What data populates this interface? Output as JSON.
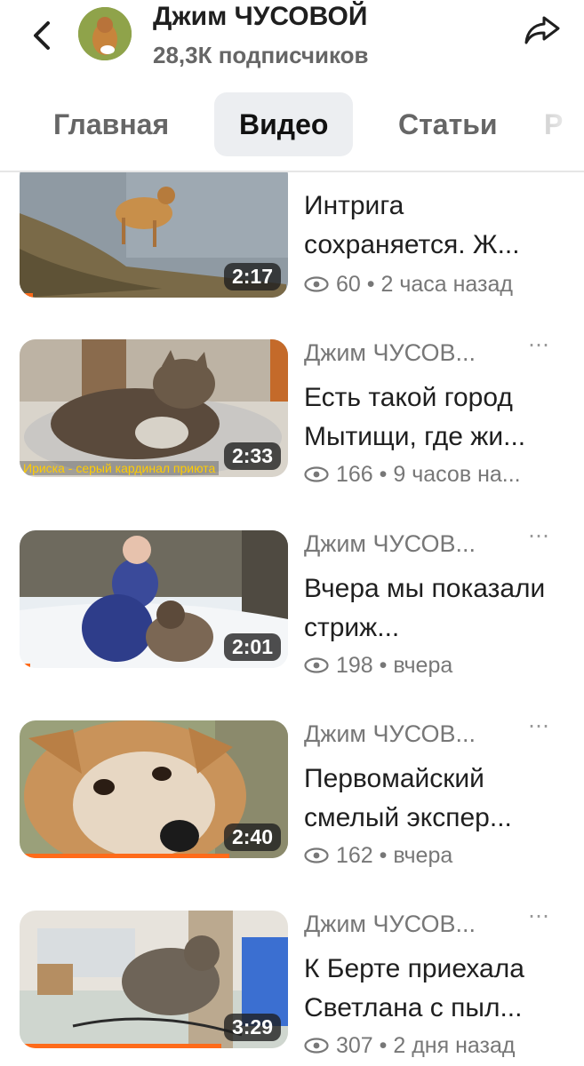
{
  "header": {
    "channel_name": "Джим ЧУСОВОЙ",
    "subscribers": "28,3К подписчиков"
  },
  "tabs": [
    {
      "label": "Главная",
      "active": false
    },
    {
      "label": "Видео",
      "active": true
    },
    {
      "label": "Статьи",
      "active": false
    },
    {
      "label": "Р",
      "active": false
    }
  ],
  "videos": [
    {
      "author": "",
      "title": "Интрига сохраняется. Ж...",
      "views": "60",
      "time": "2 часа назад",
      "duration": "2:17",
      "progress": 0.05,
      "caption": ""
    },
    {
      "author": "Джим ЧУСОВ...",
      "title": "Есть такой город Мытищи, где жи...",
      "views": "166",
      "time": "9 часов на...",
      "duration": "2:33",
      "progress": 0.0,
      "caption": "Ириска - серый кардинал приюта"
    },
    {
      "author": "Джим ЧУСОВ...",
      "title": "Вчера мы показали стриж...",
      "views": "198",
      "time": "вчера",
      "duration": "2:01",
      "progress": 0.04,
      "caption": ""
    },
    {
      "author": "Джим ЧУСОВ...",
      "title": "Первомайский смелый экспер...",
      "views": "162",
      "time": "вчера",
      "duration": "2:40",
      "progress": 0.78,
      "caption": ""
    },
    {
      "author": "Джим ЧУСОВ...",
      "title": "К Берте приехала Светлана с пыл...",
      "views": "307",
      "time": "2 дня назад",
      "duration": "3:29",
      "progress": 0.75,
      "caption": ""
    }
  ],
  "colors": {
    "accent": "#ff6b1a",
    "tab_active_bg": "#eceef1",
    "muted": "#777777"
  }
}
